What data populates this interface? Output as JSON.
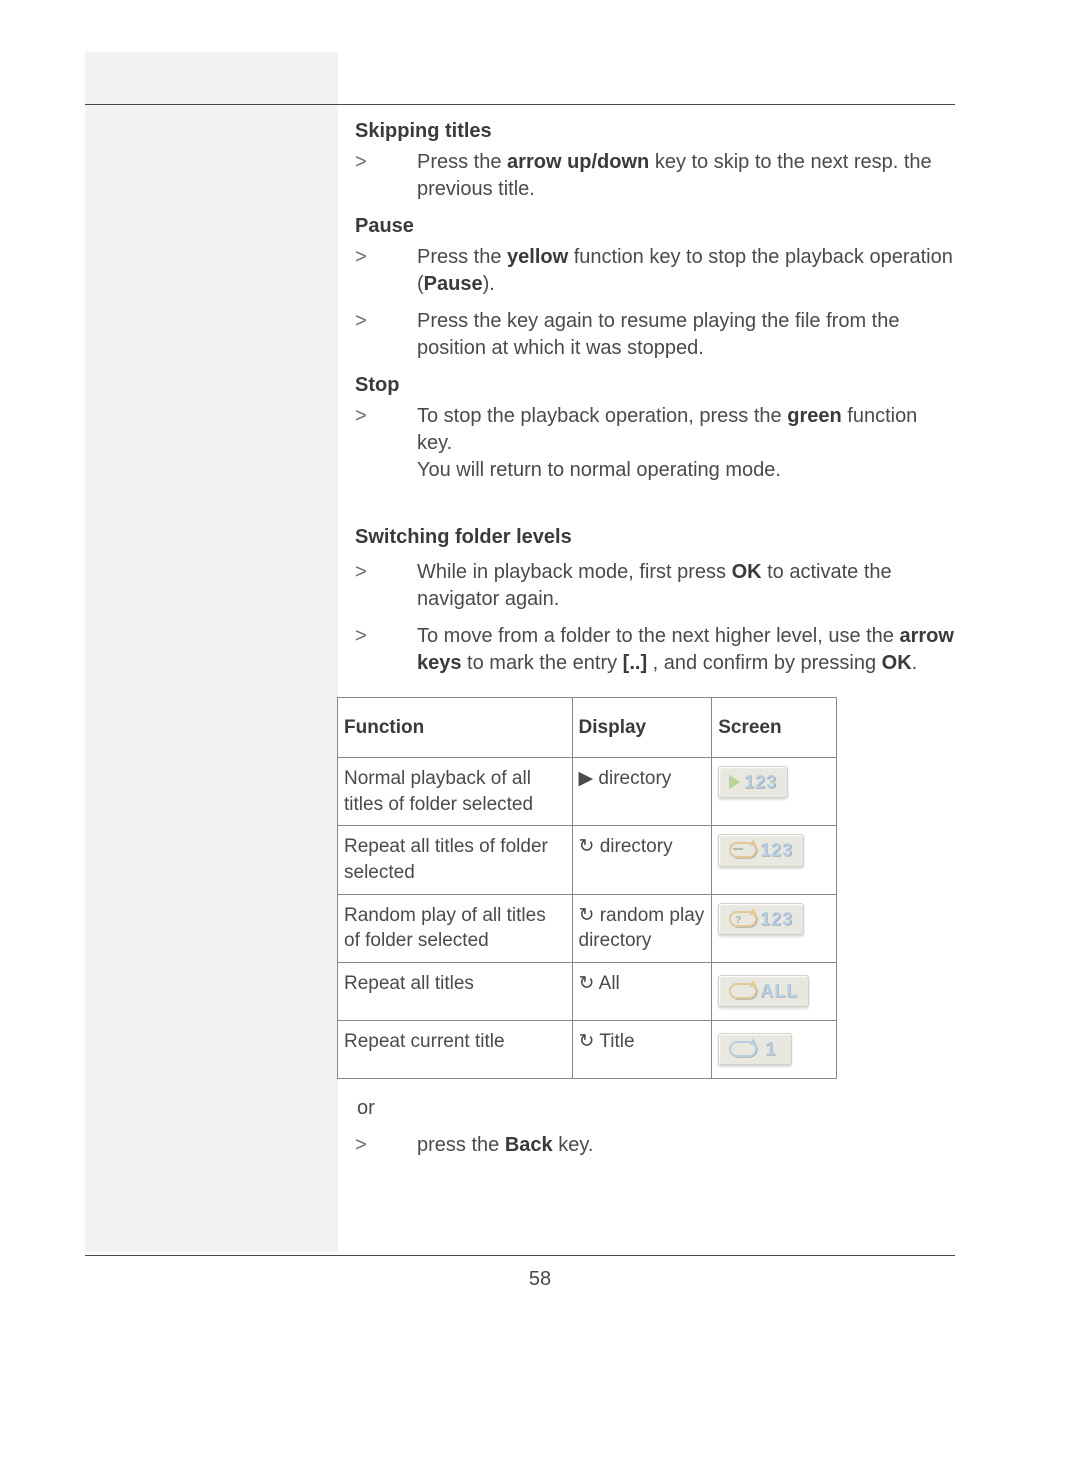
{
  "page_number": "58",
  "sections": {
    "skipping": {
      "title": "Skipping titles",
      "item1_pre": "Press the ",
      "item1_bold": "arrow up/down",
      "item1_post": " key to skip to the next resp. the previous title."
    },
    "pause": {
      "title": "Pause",
      "item1_pre": "Press the ",
      "item1_bold1": "yellow",
      "item1_mid": " function key to stop the playback operation (",
      "item1_bold2": "Pause",
      "item1_post": ").",
      "item2": "Press the key again to resume playing the file from the position at which it was stopped."
    },
    "stop": {
      "title": "Stop",
      "item1_pre": "To stop the playback operation, press the ",
      "item1_bold": "green",
      "item1_mid": " func­tion key.",
      "item1_line2": "You will return to normal operating mode."
    },
    "switching": {
      "title": "Switching folder levels",
      "item1_pre": "While in playback mode, first press ",
      "item1_bold": "OK",
      "item1_post": " to activate the navigator again.",
      "item2_pre": "To move from a folder to the next higher level, use the ",
      "item2_bold1": "arrow keys",
      "item2_mid": " to mark the entry ",
      "item2_bold2": "[..]",
      "item2_post": " , and confirm by pressing ",
      "item2_bold3": "OK",
      "item2_end": "."
    }
  },
  "table": {
    "headers": {
      "c1": "Function",
      "c2": "Display",
      "c3": "Screen"
    },
    "rows": [
      {
        "func": "Normal playback of all titles of folder selected",
        "disp_sym": "▶",
        "disp_text": " directory",
        "screen_type": "play",
        "screen_text": "123"
      },
      {
        "func": "Repeat all titles of folder selected",
        "disp_sym": "↻",
        "disp_text": " directory",
        "screen_type": "repeat_dash",
        "screen_text": "123"
      },
      {
        "func": "Random play of all titles of folder selected",
        "disp_sym": "↻",
        "disp_text": " random play directory",
        "screen_type": "repeat_rand",
        "screen_text": "123"
      },
      {
        "func": "Repeat all titles",
        "disp_sym": "↻",
        "disp_text": " All",
        "screen_type": "repeat_plain",
        "screen_text": "ALL"
      },
      {
        "func": "Repeat current title",
        "disp_sym": "↻",
        "disp_text": " Title",
        "screen_type": "repeat_blue",
        "screen_text": "1"
      }
    ]
  },
  "or_text": "or",
  "back_item_pre": "press the ",
  "back_item_bold": "Back",
  "back_item_post": " key.",
  "bullet": ">"
}
